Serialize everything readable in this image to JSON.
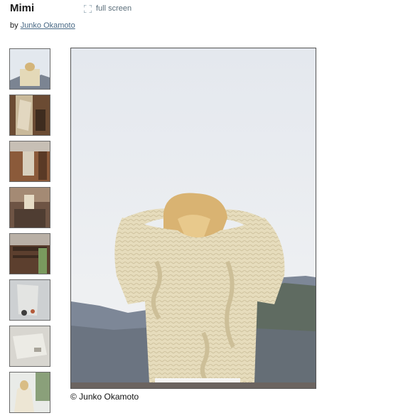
{
  "product": {
    "title": "Mimi"
  },
  "toolbar": {
    "fullscreen_label": "full screen",
    "fullscreen_icon": "expand-icon"
  },
  "byline": {
    "prefix": "by",
    "designer": "Junko Okamoto"
  },
  "gallery": {
    "thumbnail_count": 8,
    "main_caption": "© Junko Okamoto"
  },
  "colors": {
    "link": "#4a6a86",
    "fullscreen_text": "#5b6e7a",
    "sweater": "#e6dcbc"
  }
}
